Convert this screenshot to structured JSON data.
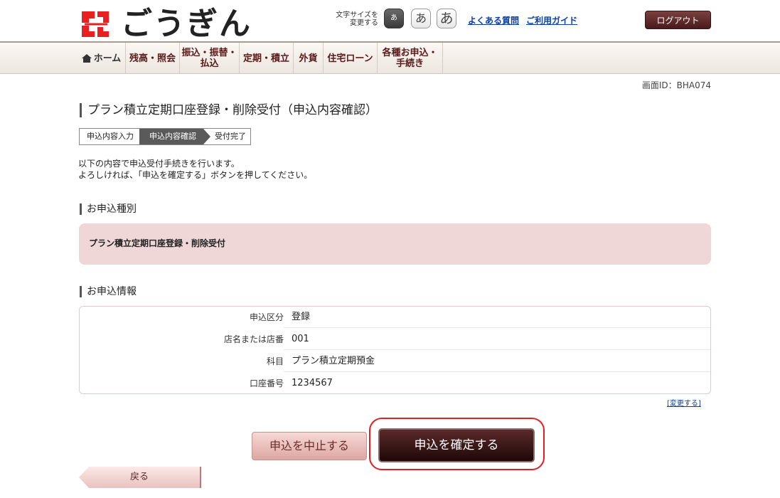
{
  "header": {
    "logo_text": "ごうぎん",
    "font_size_label": "文字サイズを\n変更する",
    "font_sizes": [
      "あ",
      "あ",
      "あ"
    ],
    "links": [
      "よくある質問",
      "ご利用ガイド"
    ],
    "logout_label": "ログアウト",
    "logo_color": "#e8201f"
  },
  "nav": {
    "items": [
      {
        "label": "ホーム"
      },
      {
        "label": "残高・照会"
      },
      {
        "label": "振込・振替・\n払込"
      },
      {
        "label": "定期・積立"
      },
      {
        "label": "外貨"
      },
      {
        "label": "住宅ローン"
      },
      {
        "label": "各種お申込・\n手続き"
      }
    ]
  },
  "screen_id": "画面ID：BHA074",
  "page_title": "プラン積立定期口座登録・削除受付（申込内容確認）",
  "steps": [
    "申込内容入力",
    "申込内容確認",
    "受付完了"
  ],
  "lead": "以下の内容で申込受付手続きを行います。\nよろしければ、「申込を確定する」ボタンを押してください。",
  "section_type": {
    "heading": "お申込種別",
    "value": "プラン積立定期口座登録・削除受付"
  },
  "section_info": {
    "heading": "お申込情報",
    "rows": [
      {
        "label": "申込区分",
        "value": "登録"
      },
      {
        "label": "店名または店番",
        "value": "001"
      },
      {
        "label": "科目",
        "value": "プラン積立定期預金"
      },
      {
        "label": "口座番号",
        "value": "1234567"
      }
    ],
    "change_link": "[変更する]"
  },
  "buttons": {
    "cancel": "申込を中止する",
    "confirm": "申込を確定する",
    "back": "戻る"
  }
}
